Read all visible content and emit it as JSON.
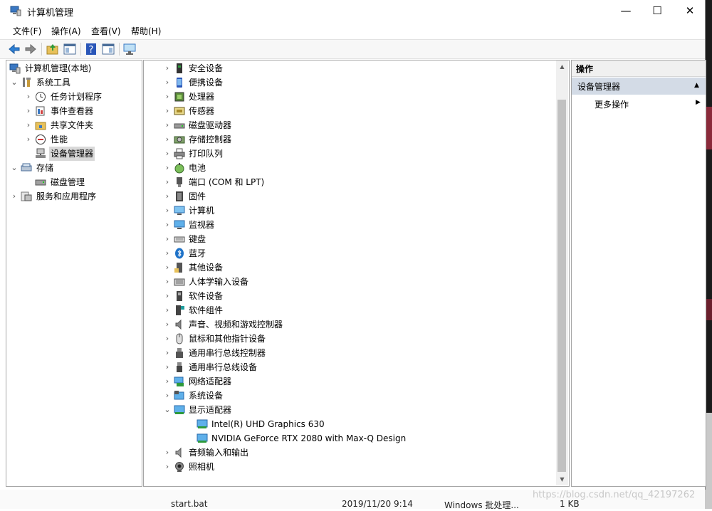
{
  "window": {
    "title": "计算机管理",
    "controls": {
      "minimize": "—",
      "maximize": "☐",
      "close": "✕"
    }
  },
  "menu": [
    "文件(F)",
    "操作(A)",
    "查看(V)",
    "帮助(H)"
  ],
  "toolbar": [
    "back-icon",
    "forward-icon",
    "up-folder-icon",
    "show-hide-tree-icon",
    "help-icon",
    "console-tree-icon",
    "monitor-icon"
  ],
  "tree": {
    "root": "计算机管理(本地)",
    "items": [
      {
        "label": "系统工具",
        "level": 1,
        "expander": "⌄",
        "icon": "tools-icon"
      },
      {
        "label": "任务计划程序",
        "level": 2,
        "expander": "›",
        "icon": "clock-icon"
      },
      {
        "label": "事件查看器",
        "level": 2,
        "expander": "›",
        "icon": "event-icon"
      },
      {
        "label": "共享文件夹",
        "level": 2,
        "expander": "›",
        "icon": "shared-folder-icon"
      },
      {
        "label": "性能",
        "level": 2,
        "expander": "›",
        "icon": "performance-icon"
      },
      {
        "label": "设备管理器",
        "level": 2,
        "expander": "",
        "icon": "device-manager-icon",
        "selected": true
      },
      {
        "label": "存储",
        "level": 1,
        "expander": "⌄",
        "icon": "storage-icon"
      },
      {
        "label": "磁盘管理",
        "level": 2,
        "expander": "",
        "icon": "disk-management-icon"
      },
      {
        "label": "服务和应用程序",
        "level": 1,
        "expander": "›",
        "icon": "services-icon"
      }
    ]
  },
  "devices": [
    {
      "label": "安全设备",
      "icon": "security-device-icon",
      "expander": "›"
    },
    {
      "label": "便携设备",
      "icon": "portable-device-icon",
      "expander": "›"
    },
    {
      "label": "处理器",
      "icon": "processor-icon",
      "expander": "›"
    },
    {
      "label": "传感器",
      "icon": "sensor-icon",
      "expander": "›"
    },
    {
      "label": "磁盘驱动器",
      "icon": "disk-drive-icon",
      "expander": "›"
    },
    {
      "label": "存储控制器",
      "icon": "storage-controller-icon",
      "expander": "›"
    },
    {
      "label": "打印队列",
      "icon": "printer-icon",
      "expander": "›"
    },
    {
      "label": "电池",
      "icon": "battery-icon",
      "expander": "›"
    },
    {
      "label": "端口 (COM 和 LPT)",
      "icon": "port-icon",
      "expander": "›"
    },
    {
      "label": "固件",
      "icon": "firmware-icon",
      "expander": "›"
    },
    {
      "label": "计算机",
      "icon": "computer-icon",
      "expander": "›"
    },
    {
      "label": "监视器",
      "icon": "monitor-icon",
      "expander": "›"
    },
    {
      "label": "键盘",
      "icon": "keyboard-icon",
      "expander": "›"
    },
    {
      "label": "蓝牙",
      "icon": "bluetooth-icon",
      "expander": "›"
    },
    {
      "label": "其他设备",
      "icon": "other-device-icon",
      "expander": "›"
    },
    {
      "label": "人体学输入设备",
      "icon": "hid-icon",
      "expander": "›"
    },
    {
      "label": "软件设备",
      "icon": "software-device-icon",
      "expander": "›"
    },
    {
      "label": "软件组件",
      "icon": "software-component-icon",
      "expander": "›"
    },
    {
      "label": "声音、视频和游戏控制器",
      "icon": "sound-icon",
      "expander": "›"
    },
    {
      "label": "鼠标和其他指针设备",
      "icon": "mouse-icon",
      "expander": "›"
    },
    {
      "label": "通用串行总线控制器",
      "icon": "usb-icon",
      "expander": "›"
    },
    {
      "label": "通用串行总线设备",
      "icon": "usb-device-icon",
      "expander": "›"
    },
    {
      "label": "网络适配器",
      "icon": "network-adapter-icon",
      "expander": "›"
    },
    {
      "label": "系统设备",
      "icon": "system-device-icon",
      "expander": "›"
    },
    {
      "label": "显示适配器",
      "icon": "display-adapter-icon",
      "expander": "⌄"
    },
    {
      "label": "Intel(R) UHD Graphics 630",
      "icon": "display-adapter-icon",
      "expander": "",
      "child": true
    },
    {
      "label": "NVIDIA GeForce RTX 2080 with Max-Q Design",
      "icon": "display-adapter-icon",
      "expander": "",
      "child": true
    },
    {
      "label": "音频输入和输出",
      "icon": "audio-icon",
      "expander": "›"
    },
    {
      "label": "照相机",
      "icon": "camera-icon",
      "expander": "›"
    }
  ],
  "actions": {
    "header": "操作",
    "section": "设备管理器",
    "section_caret": "▲",
    "more": "更多操作",
    "more_caret": "▶"
  },
  "bottom": {
    "file": "start.bat",
    "date": "2019/11/20 9:14",
    "type": "Windows 批处理...",
    "size": "1 KB",
    "watermark": "https://blog.csdn.net/qq_42197262"
  },
  "colors": {
    "section_bg": "#d3dbe6",
    "selection_bg": "#d9d9d9",
    "accent_blue": "#1e72c8"
  }
}
